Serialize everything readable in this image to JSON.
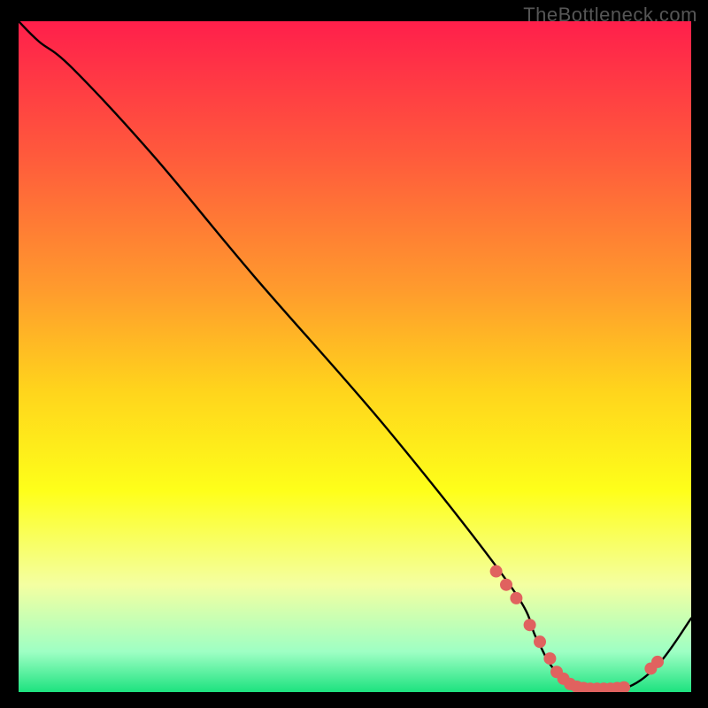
{
  "attribution": "TheBottleneck.com",
  "chart_data": {
    "type": "line",
    "title": "",
    "xlabel": "",
    "ylabel": "",
    "x_range": [
      0,
      100
    ],
    "y_range": [
      0,
      100
    ],
    "curve": {
      "name": "bottleneck-curve",
      "x": [
        0,
        3,
        8,
        20,
        35,
        55,
        73,
        77,
        80,
        85,
        90,
        95,
        100
      ],
      "y": [
        100,
        97,
        93,
        80,
        62,
        39,
        16,
        8,
        3,
        0.5,
        0.5,
        4,
        11
      ]
    },
    "points": {
      "name": "sampled-points",
      "x": [
        71,
        72.5,
        74,
        76,
        77.5,
        79,
        80,
        81,
        82,
        83,
        84,
        85,
        86,
        87,
        88,
        89,
        90,
        94,
        95
      ],
      "y": [
        18,
        16,
        14,
        10,
        7.5,
        5,
        3,
        2,
        1.2,
        0.8,
        0.6,
        0.5,
        0.5,
        0.5,
        0.5,
        0.6,
        0.7,
        3.5,
        4.5
      ]
    },
    "gradient_stops": [
      {
        "offset": 0.0,
        "color": "#ff1f4b"
      },
      {
        "offset": 0.2,
        "color": "#ff5a3c"
      },
      {
        "offset": 0.4,
        "color": "#ff9b2d"
      },
      {
        "offset": 0.55,
        "color": "#ffd41c"
      },
      {
        "offset": 0.7,
        "color": "#feff1a"
      },
      {
        "offset": 0.84,
        "color": "#f4ffa1"
      },
      {
        "offset": 0.94,
        "color": "#9effc4"
      },
      {
        "offset": 1.0,
        "color": "#1de27f"
      }
    ],
    "point_color": "#e0625f",
    "curve_color": "#000000"
  }
}
